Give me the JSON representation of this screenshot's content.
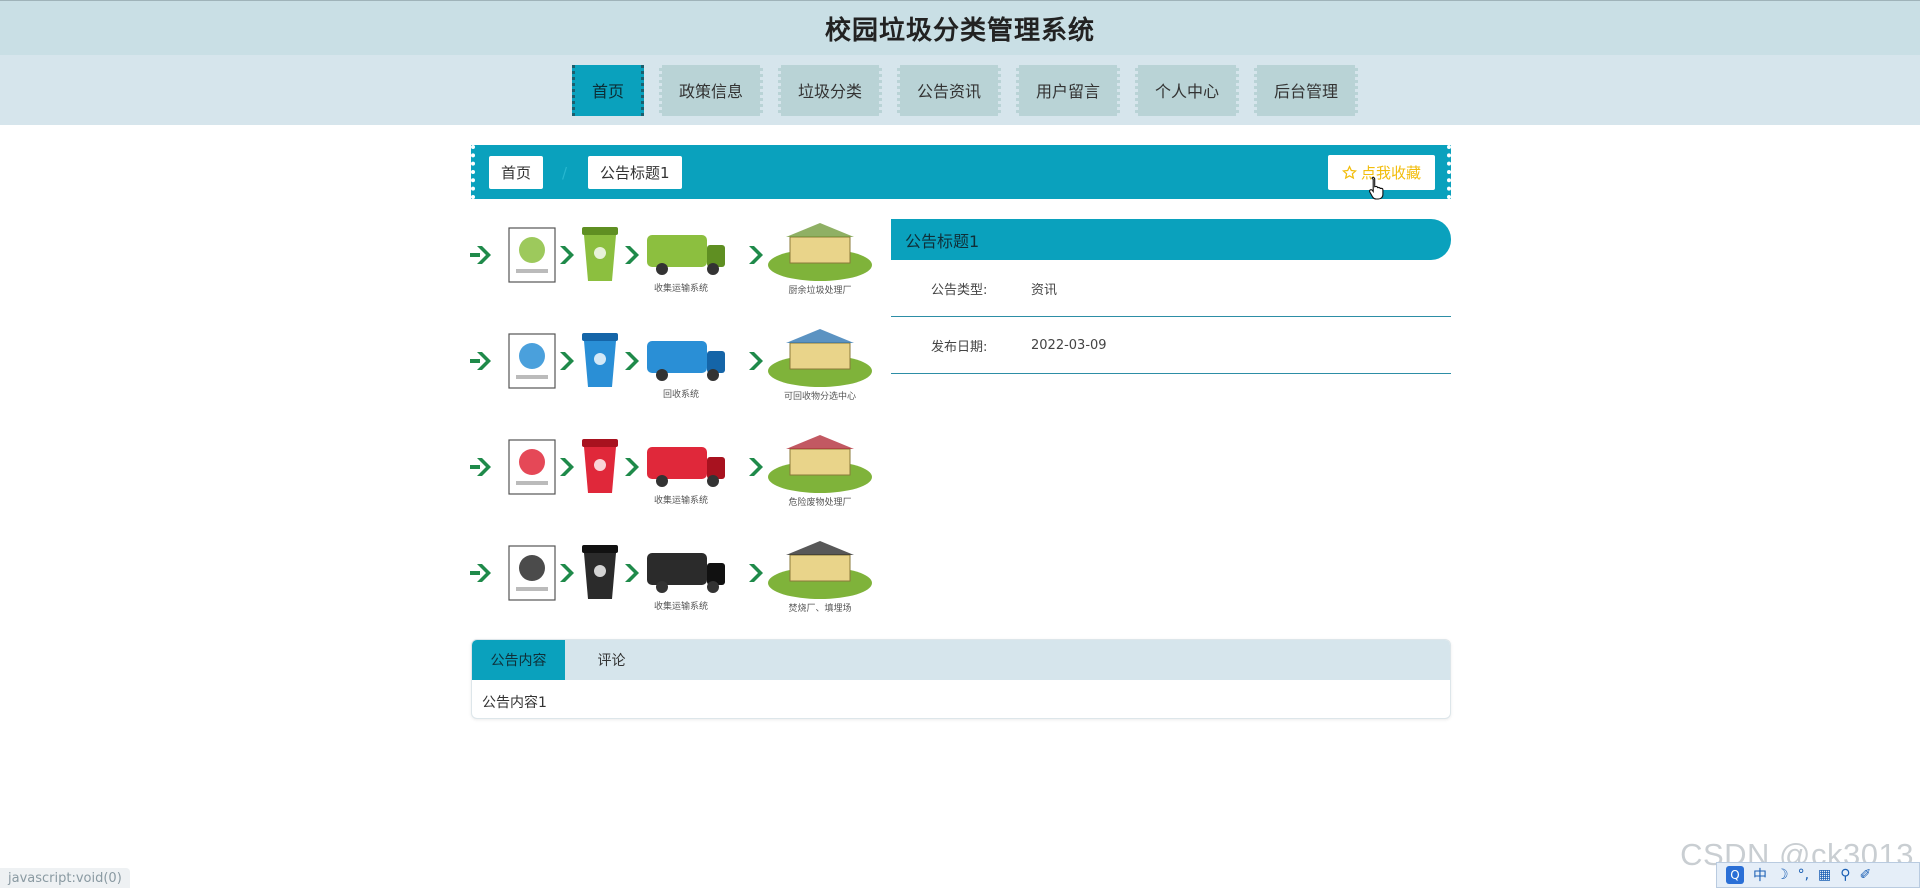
{
  "header": {
    "title": "校园垃圾分类管理系统"
  },
  "nav": {
    "items": [
      {
        "label": "首页",
        "active": true
      },
      {
        "label": "政策信息",
        "active": false
      },
      {
        "label": "垃圾分类",
        "active": false
      },
      {
        "label": "公告资讯",
        "active": false
      },
      {
        "label": "用户留言",
        "active": false
      },
      {
        "label": "个人中心",
        "active": false
      },
      {
        "label": "后台管理",
        "active": false
      }
    ]
  },
  "breadcrumb": {
    "home": "首页",
    "separator": "/",
    "current": "公告标题1"
  },
  "favorite": {
    "label": "点我收藏",
    "icon": "star-icon"
  },
  "image": {
    "rows": [
      {
        "color": "#8cbf3f",
        "dark": "#5f8f22",
        "caption1": "收集运输系统",
        "caption2": "厨余垃圾处理厂"
      },
      {
        "color": "#2a8fd6",
        "dark": "#1565a8",
        "caption1": "回收系统",
        "caption2": "可回收物分选中心"
      },
      {
        "color": "#e0283a",
        "dark": "#a8121f",
        "caption1": "收集运输系统",
        "caption2": "危险废物处理厂"
      },
      {
        "color": "#2b2b2b",
        "dark": "#111111",
        "caption1": "收集运输系统",
        "caption2": "焚烧厂、填埋场"
      }
    ],
    "arrow_color": "#1f8a4a"
  },
  "detail": {
    "title": "公告标题1",
    "fields": [
      {
        "label": "公告类型:",
        "value": "资讯"
      },
      {
        "label": "发布日期:",
        "value": "2022-03-09"
      }
    ]
  },
  "tabs": {
    "items": [
      {
        "label": "公告内容",
        "active": true
      },
      {
        "label": "评论",
        "active": false
      }
    ],
    "content": "公告内容1"
  },
  "status_bar": {
    "text": "javascript:void(0)"
  },
  "watermark": {
    "text": "CSDN @ck3013"
  },
  "ime": {
    "items": [
      "中",
      "☽",
      "°,",
      "▦",
      "⚲",
      "✐"
    ]
  },
  "colors": {
    "accent": "#0aa1bd",
    "header_bg": "#c9dfe5",
    "nav_bg": "#d6e5ec",
    "fav_text": "#f2bd0c"
  }
}
